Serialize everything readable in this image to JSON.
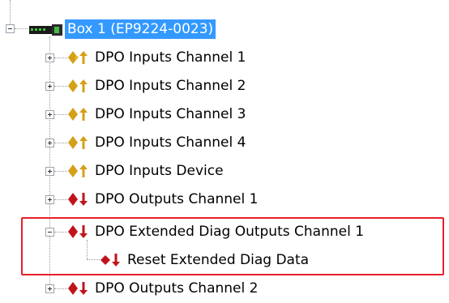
{
  "tree": {
    "root": {
      "label": "Box 1 (EP9224-0023)",
      "expanded": true,
      "selected": true,
      "icon": "ethercat-box-icon"
    },
    "children": [
      {
        "label": "DPO Inputs Channel 1",
        "icon": "input-pdo-icon",
        "expanded": false
      },
      {
        "label": "DPO Inputs Channel 2",
        "icon": "input-pdo-icon",
        "expanded": false
      },
      {
        "label": "DPO Inputs Channel 3",
        "icon": "input-pdo-icon",
        "expanded": false
      },
      {
        "label": "DPO Inputs Channel 4",
        "icon": "input-pdo-icon",
        "expanded": false
      },
      {
        "label": "DPO Inputs Device",
        "icon": "input-pdo-icon",
        "expanded": false
      },
      {
        "label": "DPO Outputs Channel 1",
        "icon": "output-pdo-icon",
        "expanded": false
      },
      {
        "label": "DPO Extended Diag Outputs Channel 1",
        "icon": "output-pdo-icon",
        "expanded": true,
        "children": [
          {
            "label": "Reset Extended Diag Data",
            "icon": "output-variable-icon"
          }
        ]
      },
      {
        "label": "DPO Outputs Channel 2",
        "icon": "output-pdo-icon",
        "expanded": false
      }
    ]
  },
  "colors": {
    "selection": "#3399ff",
    "highlight_border": "#e8202a",
    "input_icon": "#d4a017",
    "output_icon": "#c0141c"
  }
}
